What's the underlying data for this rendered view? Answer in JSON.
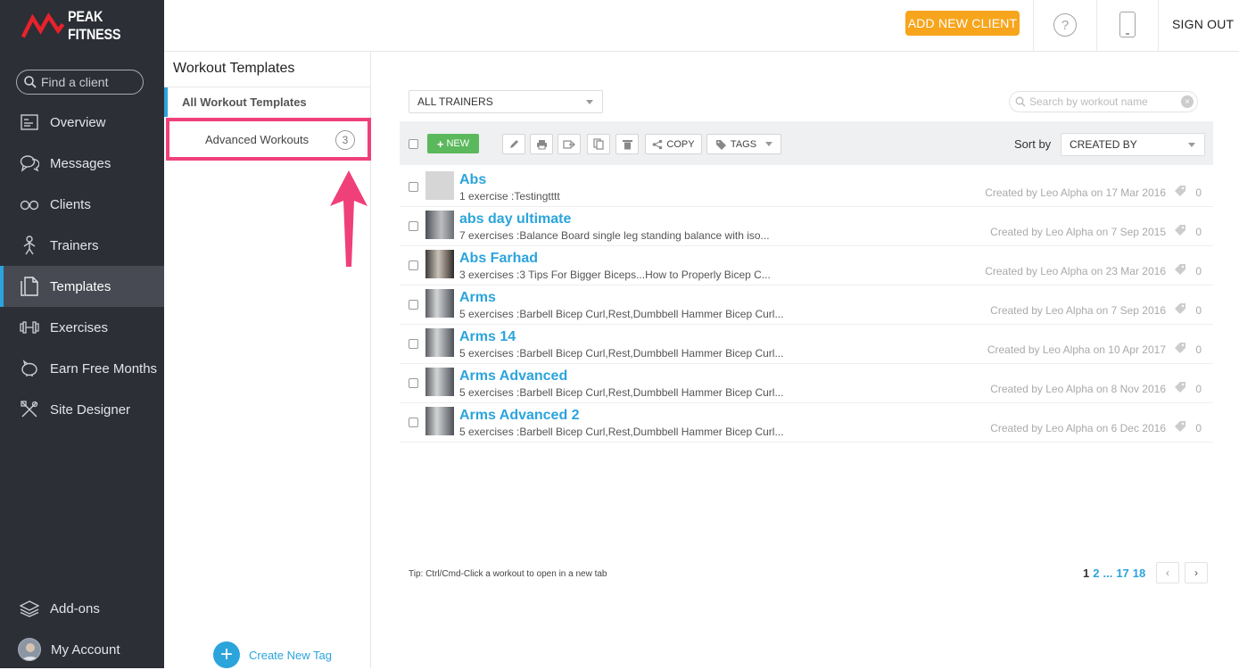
{
  "brand": {
    "name": "PEAK FITNESS"
  },
  "search": {
    "placeholder": "Find a client"
  },
  "nav": {
    "items": [
      {
        "label": "Overview",
        "icon": "overview-icon"
      },
      {
        "label": "Messages",
        "icon": "messages-icon"
      },
      {
        "label": "Clients",
        "icon": "clients-icon"
      },
      {
        "label": "Trainers",
        "icon": "trainers-icon"
      },
      {
        "label": "Templates",
        "icon": "templates-icon",
        "active": true
      },
      {
        "label": "Exercises",
        "icon": "dumbbell-icon"
      },
      {
        "label": "Earn Free Months",
        "icon": "piggy-bank-icon"
      },
      {
        "label": "Site Designer",
        "icon": "tools-icon"
      }
    ],
    "bottom": [
      {
        "label": "Add-ons",
        "icon": "layers-icon"
      },
      {
        "label": "My Account",
        "icon": "avatar"
      }
    ]
  },
  "topbar": {
    "add_client": "ADD NEW CLIENT",
    "help": "?",
    "sign_out": "SIGN OUT"
  },
  "templates_panel": {
    "title": "Workout Templates",
    "all": "All Workout Templates",
    "tag": {
      "label": "Advanced Workouts",
      "count": "3"
    },
    "create_tag": "Create New Tag"
  },
  "filters": {
    "trainers": "ALL TRAINERS",
    "search_placeholder": "Search by workout name",
    "sort_label": "Sort by",
    "sort_value": "CREATED BY"
  },
  "toolbar": {
    "new": "NEW",
    "copy": "COPY",
    "tags": "TAGS"
  },
  "workouts": [
    {
      "title": "Abs",
      "sub": "1 exercise :Testingtttt",
      "meta": "Created by Leo Alpha on 17 Mar 2016",
      "tags": "0",
      "thumb": "blank"
    },
    {
      "title": "abs day ultimate",
      "sub": "7 exercises :Balance Board single leg standing balance with iso...",
      "meta": "Created by Leo Alpha on 7 Sep 2015",
      "tags": "0",
      "thumb": "photo"
    },
    {
      "title": "Abs Farhad",
      "sub": "3 exercises :3 Tips For Bigger Biceps...How to Properly Bicep C...",
      "meta": "Created by Leo Alpha on 23 Mar 2016",
      "tags": "0",
      "thumb": "photo2"
    },
    {
      "title": "Arms",
      "sub": "5 exercises :Barbell Bicep Curl,Rest,Dumbbell Hammer Bicep Curl...",
      "meta": "Created by Leo Alpha on 7 Sep 2016",
      "tags": "0",
      "thumb": "photo3"
    },
    {
      "title": "Arms 14",
      "sub": "5 exercises :Barbell Bicep Curl,Rest,Dumbbell Hammer Bicep Curl...",
      "meta": "Created by Leo Alpha on 10 Apr 2017",
      "tags": "0",
      "thumb": "photo3"
    },
    {
      "title": "Arms Advanced",
      "sub": "5 exercises :Barbell Bicep Curl,Rest,Dumbbell Hammer Bicep Curl...",
      "meta": "Created by Leo Alpha on 8 Nov 2016",
      "tags": "0",
      "thumb": "photo3"
    },
    {
      "title": "Arms Advanced 2",
      "sub": "5 exercises :Barbell Bicep Curl,Rest,Dumbbell Hammer Bicep Curl...",
      "meta": "Created by Leo Alpha on 6 Dec 2016",
      "tags": "0",
      "thumb": "photo3"
    }
  ],
  "footer": {
    "tip": "Tip: Ctrl/Cmd-Click a workout to open in a new tab",
    "pages": {
      "current": "1",
      "p2": "2",
      "ellipsis": "...",
      "p17": "17",
      "p18": "18"
    }
  },
  "colors": {
    "accent": "#2ba4dc",
    "cta": "#f7a51c",
    "highlight": "#f0407a",
    "sidebar": "#2c2f36",
    "new_button": "#5cb85c"
  }
}
